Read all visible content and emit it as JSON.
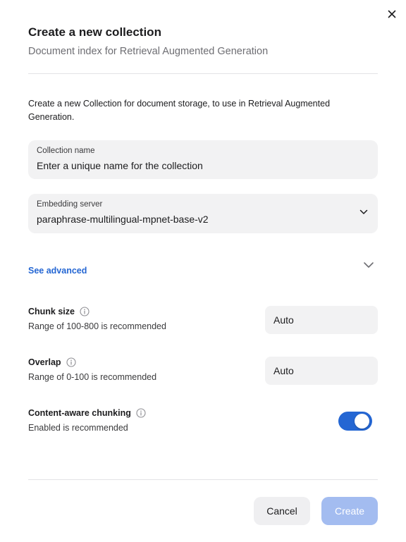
{
  "dialog": {
    "title": "Create a new collection",
    "subtitle": "Document index for Retrieval Augmented Generation",
    "description": "Create a new Collection for document storage, to use in Retrieval Augmented Generation."
  },
  "collection_name": {
    "label": "Collection name",
    "placeholder": "Enter a unique name for the collection",
    "value": ""
  },
  "embedding_server": {
    "label": "Embedding server",
    "selected": "paraphrase-multilingual-mpnet-base-v2"
  },
  "advanced": {
    "toggle_label": "See advanced",
    "chunk_size": {
      "label": "Chunk size",
      "hint": "Range of 100-800 is recommended",
      "placeholder": "Auto"
    },
    "overlap": {
      "label": "Overlap",
      "hint": "Range of 0-100 is recommended",
      "placeholder": "Auto"
    },
    "content_aware": {
      "label": "Content-aware chunking",
      "hint": "Enabled is recommended",
      "enabled": true
    }
  },
  "footer": {
    "cancel_label": "Cancel",
    "create_label": "Create",
    "create_disabled": true
  },
  "colors": {
    "accent": "#2466d3",
    "create_disabled": "#a3bcf0",
    "field_bg": "#f2f2f3"
  },
  "icons": {
    "close": "close-icon",
    "dropdown": "chevron-down-icon",
    "info": "info-icon"
  }
}
